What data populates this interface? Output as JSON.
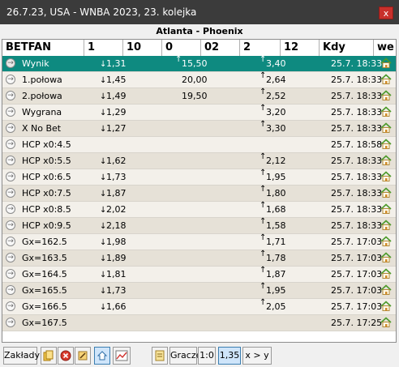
{
  "window": {
    "title": "26.7.23, USA - WNBA 2023, 23. kolejka",
    "close_label": "x"
  },
  "match": "Atlanta - Phoenix",
  "columns": [
    "BETFAN",
    "1",
    "10",
    "0",
    "02",
    "2",
    "12",
    "Kdy",
    "we"
  ],
  "rows": [
    {
      "name": "Wynik",
      "c1": "1,31",
      "c1dir": "down",
      "c0": "15,50",
      "c0dir": "up",
      "c2": "3,40",
      "c2dir": "up",
      "time": "25.7. 18:33"
    },
    {
      "name": "1.połowa",
      "c1": "1,45",
      "c1dir": "down",
      "c0": "20,00",
      "c0dir": "",
      "c2": "2,64",
      "c2dir": "up",
      "time": "25.7. 18:33"
    },
    {
      "name": "2.połowa",
      "c1": "1,49",
      "c1dir": "down",
      "c0": "19,50",
      "c0dir": "",
      "c2": "2,52",
      "c2dir": "up",
      "time": "25.7. 18:33"
    },
    {
      "name": "Wygrana",
      "c1": "1,29",
      "c1dir": "down",
      "c0": "",
      "c0dir": "",
      "c2": "3,20",
      "c2dir": "up",
      "time": "25.7. 18:33"
    },
    {
      "name": "X No Bet",
      "c1": "1,27",
      "c1dir": "down",
      "c0": "",
      "c0dir": "",
      "c2": "3,30",
      "c2dir": "up",
      "time": "25.7. 18:33"
    },
    {
      "name": "HCP x0:4.5",
      "c1": "",
      "c1dir": "",
      "c0": "",
      "c0dir": "",
      "c2": "",
      "c2dir": "",
      "time": "25.7. 18:58"
    },
    {
      "name": "HCP x0:5.5",
      "c1": "1,62",
      "c1dir": "down",
      "c0": "",
      "c0dir": "",
      "c2": "2,12",
      "c2dir": "up",
      "time": "25.7. 18:33"
    },
    {
      "name": "HCP x0:6.5",
      "c1": "1,73",
      "c1dir": "down",
      "c0": "",
      "c0dir": "",
      "c2": "1,95",
      "c2dir": "up",
      "time": "25.7. 18:33"
    },
    {
      "name": "HCP x0:7.5",
      "c1": "1,87",
      "c1dir": "down",
      "c0": "",
      "c0dir": "",
      "c2": "1,80",
      "c2dir": "up",
      "time": "25.7. 18:33"
    },
    {
      "name": "HCP x0:8.5",
      "c1": "2,02",
      "c1dir": "down",
      "c0": "",
      "c0dir": "",
      "c2": "1,68",
      "c2dir": "up",
      "time": "25.7. 18:33"
    },
    {
      "name": "HCP x0:9.5",
      "c1": "2,18",
      "c1dir": "down",
      "c0": "",
      "c0dir": "",
      "c2": "1,58",
      "c2dir": "up",
      "time": "25.7. 18:33"
    },
    {
      "name": "Gx=162.5",
      "c1": "1,98",
      "c1dir": "down",
      "c0": "",
      "c0dir": "",
      "c2": "1,71",
      "c2dir": "up",
      "time": "25.7. 17:03"
    },
    {
      "name": "Gx=163.5",
      "c1": "1,89",
      "c1dir": "down",
      "c0": "",
      "c0dir": "",
      "c2": "1,78",
      "c2dir": "up",
      "time": "25.7. 17:03"
    },
    {
      "name": "Gx=164.5",
      "c1": "1,81",
      "c1dir": "down",
      "c0": "",
      "c0dir": "",
      "c2": "1,87",
      "c2dir": "up",
      "time": "25.7. 17:03"
    },
    {
      "name": "Gx=165.5",
      "c1": "1,73",
      "c1dir": "down",
      "c0": "",
      "c0dir": "",
      "c2": "1,95",
      "c2dir": "up",
      "time": "25.7. 17:03"
    },
    {
      "name": "Gx=166.5",
      "c1": "1,66",
      "c1dir": "down",
      "c0": "",
      "c0dir": "",
      "c2": "2,05",
      "c2dir": "up",
      "time": "25.7. 17:03"
    },
    {
      "name": "Gx=167.5",
      "c1": "",
      "c1dir": "",
      "c0": "",
      "c0dir": "",
      "c2": "",
      "c2dir": "",
      "time": "25.7. 17:25"
    }
  ],
  "selected_row": 0,
  "toolbar": {
    "zaklady_label": "Zakłady",
    "gracze_label": "Gracze",
    "score_label": "1:0",
    "odds_label": "1,35",
    "xy_label": "x > y"
  },
  "colors": {
    "selected_row": "#0e8a80",
    "row_light": "#f3f0ea",
    "row_dark": "#e6e1d7",
    "titlebar": "#3b3b3b",
    "close": "#c8302b",
    "house": "#4c9a2a"
  }
}
